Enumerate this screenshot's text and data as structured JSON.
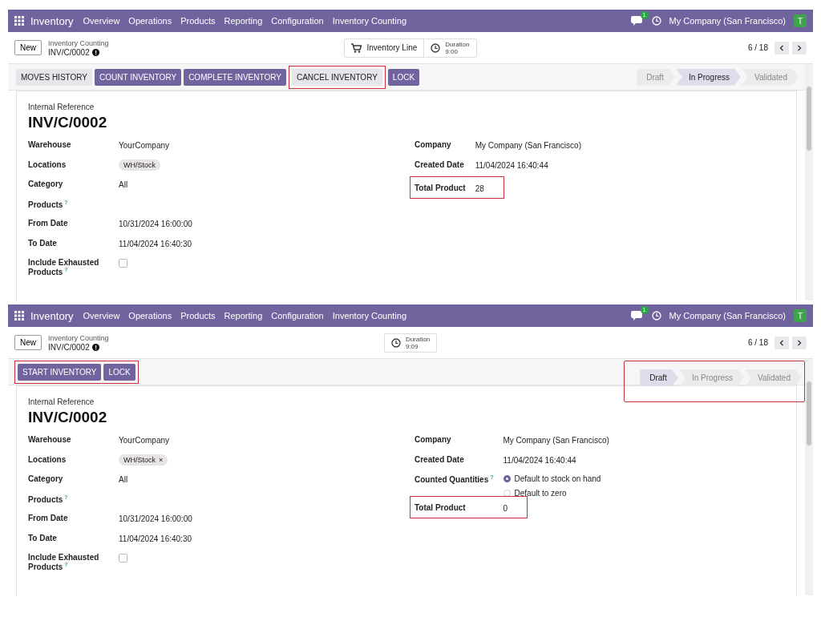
{
  "screens": [
    {
      "navbar": {
        "app": "Inventory",
        "menu": [
          "Overview",
          "Operations",
          "Products",
          "Reporting",
          "Configuration",
          "Inventory Counting"
        ],
        "chat_badge": "1",
        "company": "My Company (San Francisco)",
        "avatar": "T"
      },
      "control": {
        "new": "New",
        "breadcrumb": "Inventory Counting",
        "record": "INV/C/0002",
        "smart_buttons": [
          {
            "kind": "lines",
            "label": "Inventory Line"
          },
          {
            "kind": "duration",
            "label": "Duration",
            "value": "9:00"
          }
        ],
        "pager": "6 / 18"
      },
      "actions": {
        "highlighted": false,
        "buttons": [
          {
            "label": "MOVES HISTORY",
            "kind": "secondary",
            "highlighted": false
          },
          {
            "label": "COUNT INVENTORY",
            "kind": "primary",
            "highlighted": false
          },
          {
            "label": "COMPLETE INVENTORY",
            "kind": "primary",
            "highlighted": false
          },
          {
            "label": "CANCEL INVENTORY",
            "kind": "secondary",
            "highlighted": true
          },
          {
            "label": "LOCK",
            "kind": "primary",
            "highlighted": false
          }
        ]
      },
      "stages": {
        "highlighted": false,
        "items": [
          {
            "label": "Draft",
            "selected": false
          },
          {
            "label": "In Progress",
            "selected": true
          },
          {
            "label": "Validated",
            "selected": false
          }
        ]
      },
      "form": {
        "ref_label": "Internal Reference",
        "ref": "INV/C/0002",
        "left": [
          {
            "label": "Warehouse",
            "kind": "text",
            "value": "YourCompany"
          },
          {
            "label": "Locations",
            "kind": "tag",
            "value": "WH/Stock"
          },
          {
            "label": "Category",
            "kind": "text",
            "value": "All"
          },
          {
            "label": "Products",
            "help": "?",
            "kind": "empty"
          },
          {
            "label": "From Date",
            "kind": "text",
            "value": "10/31/2024 16:00:00"
          },
          {
            "label": "To Date",
            "kind": "text",
            "value": "11/04/2024 16:40:30"
          },
          {
            "label": "Include Exhausted Products",
            "help": "?",
            "kind": "checkbox",
            "checked": false
          }
        ],
        "right": [
          {
            "label": "Company",
            "kind": "text",
            "value": "My Company (San Francisco)"
          },
          {
            "label": "Created Date",
            "kind": "text",
            "value": "11/04/2024 16:40:44"
          },
          {
            "label": "Total Product",
            "kind": "text",
            "value": "28",
            "highlighted": true
          }
        ]
      }
    },
    {
      "navbar": {
        "app": "Inventory",
        "menu": [
          "Overview",
          "Operations",
          "Products",
          "Reporting",
          "Configuration",
          "Inventory Counting"
        ],
        "chat_badge": "1",
        "company": "My Company (San Francisco)",
        "avatar": "T"
      },
      "control": {
        "new": "New",
        "breadcrumb": "Inventory Counting",
        "record": "INV/C/0002",
        "smart_buttons": [
          {
            "kind": "duration",
            "label": "Duration",
            "value": "9:09"
          }
        ],
        "pager": "6 / 18"
      },
      "actions": {
        "highlighted": true,
        "buttons": [
          {
            "label": "START INVENTORY",
            "kind": "primary",
            "highlighted": false
          },
          {
            "label": "LOCK",
            "kind": "primary",
            "highlighted": false
          }
        ]
      },
      "stages": {
        "highlighted": true,
        "items": [
          {
            "label": "Draft",
            "selected": true
          },
          {
            "label": "In Progress",
            "selected": false
          },
          {
            "label": "Validated",
            "selected": false
          }
        ]
      },
      "form": {
        "ref_label": "Internal Reference",
        "ref": "INV/C/0002",
        "left": [
          {
            "label": "Warehouse",
            "kind": "text",
            "value": "YourCompany"
          },
          {
            "label": "Locations",
            "kind": "tag",
            "value": "WH/Stock",
            "remove": "×"
          },
          {
            "label": "Category",
            "kind": "text",
            "value": "All"
          },
          {
            "label": "Products",
            "help": "?",
            "kind": "empty"
          },
          {
            "label": "From Date",
            "kind": "text",
            "value": "10/31/2024 16:00:00"
          },
          {
            "label": "To Date",
            "kind": "text",
            "value": "11/04/2024 16:40:30"
          },
          {
            "label": "Include Exhausted Products",
            "help": "?",
            "kind": "checkbox",
            "checked": false
          }
        ],
        "right": [
          {
            "label": "Company",
            "kind": "text",
            "value": "My Company (San Francisco)"
          },
          {
            "label": "Created Date",
            "kind": "text",
            "value": "11/04/2024 16:40:44"
          },
          {
            "label": "Counted Quantities",
            "help": "?",
            "kind": "radio",
            "options": [
              {
                "label": "Default to stock on hand",
                "selected": true
              },
              {
                "label": "Default to zero",
                "selected": false
              }
            ]
          },
          {
            "label": "Total Product",
            "kind": "text",
            "value": "0",
            "highlighted": true
          }
        ]
      }
    }
  ]
}
